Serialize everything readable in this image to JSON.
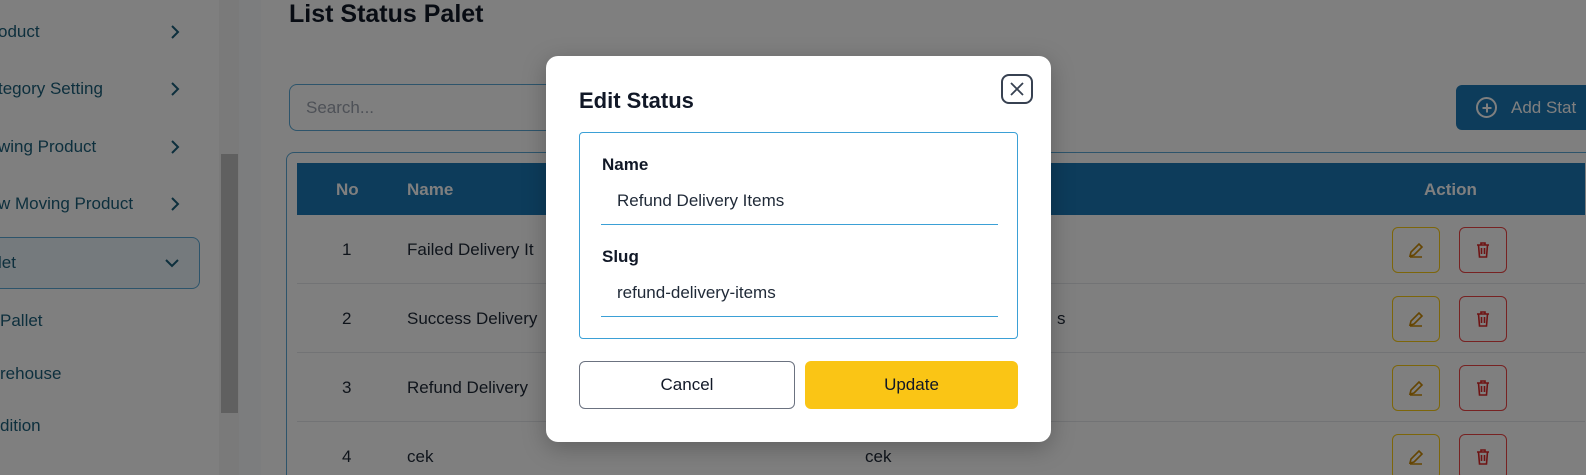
{
  "sidebar": {
    "items": [
      {
        "label": "oduct"
      },
      {
        "label": "tegory Setting"
      },
      {
        "label": "wing Product"
      },
      {
        "label": "w Moving Product"
      },
      {
        "label": "let"
      }
    ],
    "subitems": [
      {
        "label": "Pallet"
      },
      {
        "label": "rehouse"
      },
      {
        "label": "dition"
      }
    ]
  },
  "page": {
    "title": "List Status Palet",
    "search_placeholder": "Search...",
    "add_button_label": "Add Stat"
  },
  "table": {
    "headers": {
      "no": "No",
      "name": "Name",
      "action": "Action"
    },
    "rows": [
      {
        "no": "1",
        "name": "Failed Delivery It",
        "slug": ""
      },
      {
        "no": "2",
        "name": "Success Delivery",
        "slug": "s"
      },
      {
        "no": "3",
        "name": "Refund Delivery",
        "slug": ""
      },
      {
        "no": "4",
        "name": "cek",
        "slug": "cek"
      }
    ]
  },
  "modal": {
    "title": "Edit Status",
    "name_label": "Name",
    "name_value": "Refund Delivery Items",
    "slug_label": "Slug",
    "slug_value": "refund-delivery-items",
    "cancel_label": "Cancel",
    "update_label": "Update"
  },
  "colors": {
    "primary": "#1a78b6",
    "accent_yellow": "#fac515",
    "danger": "#ef4444",
    "border_blue": "#3ba0d6"
  }
}
